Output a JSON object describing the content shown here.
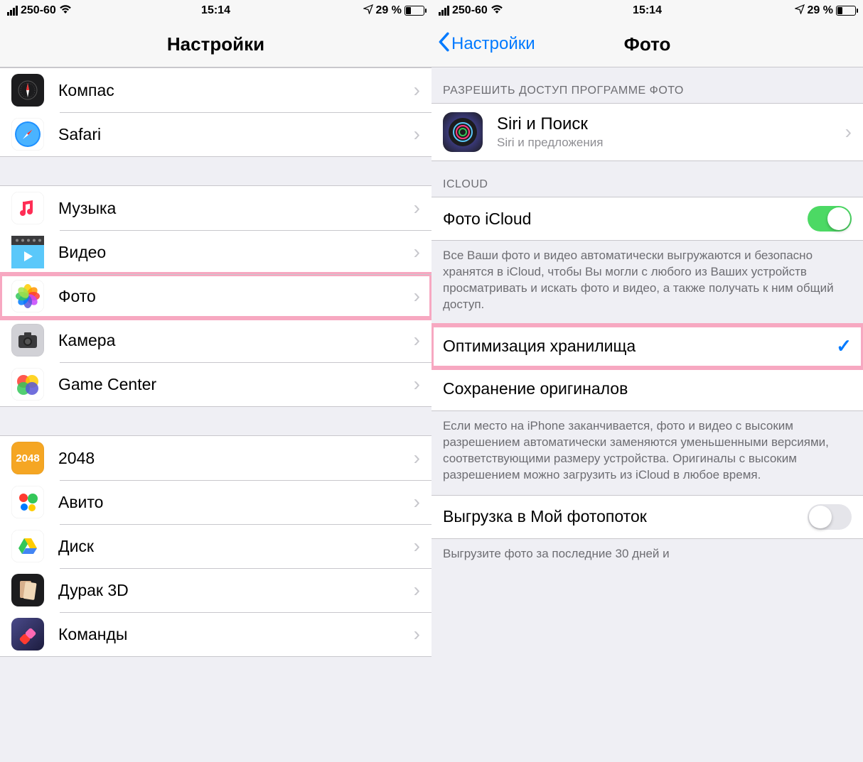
{
  "status": {
    "carrier": "250-60",
    "time": "15:14",
    "battery_pct": "29 %"
  },
  "left": {
    "title": "Настройки",
    "groups": [
      {
        "rows": [
          {
            "id": "compass",
            "label": "Компас",
            "icon": "compass-icon"
          },
          {
            "id": "safari",
            "label": "Safari",
            "icon": "safari-icon"
          }
        ]
      },
      {
        "rows": [
          {
            "id": "music",
            "label": "Музыка",
            "icon": "music-icon"
          },
          {
            "id": "video",
            "label": "Видео",
            "icon": "video-icon"
          },
          {
            "id": "photos",
            "label": "Фото",
            "icon": "photos-icon",
            "highlight": true
          },
          {
            "id": "camera",
            "label": "Камера",
            "icon": "camera-icon"
          },
          {
            "id": "gamecenter",
            "label": "Game Center",
            "icon": "gamecenter-icon"
          }
        ]
      },
      {
        "rows": [
          {
            "id": "2048",
            "label": "2048",
            "icon": "2048-icon"
          },
          {
            "id": "avito",
            "label": "Авито",
            "icon": "avito-icon"
          },
          {
            "id": "drive",
            "label": "Диск",
            "icon": "drive-icon"
          },
          {
            "id": "durak",
            "label": "Дурак 3D",
            "icon": "durak-icon"
          },
          {
            "id": "shortcuts",
            "label": "Команды",
            "icon": "shortcuts-icon"
          }
        ]
      }
    ]
  },
  "right": {
    "back": "Настройки",
    "title": "Фото",
    "section1_header": "РАЗРЕШИТЬ ДОСТУП ПРОГРАММЕ ФОТО",
    "siri": {
      "title": "Siri и Поиск",
      "sub": "Siri и предложения"
    },
    "section2_header": "ICLOUD",
    "icloud_photos_label": "Фото iCloud",
    "icloud_footer": "Все Ваши фото и видео автоматически выгружаются и безопасно хранятся в iCloud, чтобы Вы могли с любого из Ваших устройств просматривать и искать фото и видео, а также получать к ним общий доступ.",
    "optimize_label": "Оптимизация хранилища",
    "keep_originals_label": "Сохранение оригиналов",
    "optimize_footer": "Если место на iPhone заканчивается, фото и видео с высоким разрешением автоматически заменяются уменьшенными версиями, соответствующими размеру устройства. Оригиналы с высоким разрешением можно загрузить из iCloud в любое время.",
    "photostream_label": "Выгрузка в Мой фотопоток",
    "photostream_footer": "Выгрузите фото за последние 30 дней и"
  }
}
